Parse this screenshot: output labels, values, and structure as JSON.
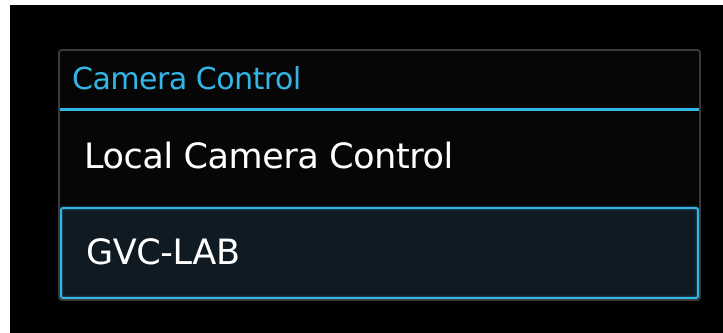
{
  "dialog": {
    "title": "Camera Control",
    "options": [
      {
        "label": "Local Camera Control",
        "selected": false
      },
      {
        "label": "GVC-LAB",
        "selected": true
      }
    ]
  },
  "colors": {
    "accent": "#33b5e5",
    "background": "#000000",
    "text": "#ffffff"
  }
}
